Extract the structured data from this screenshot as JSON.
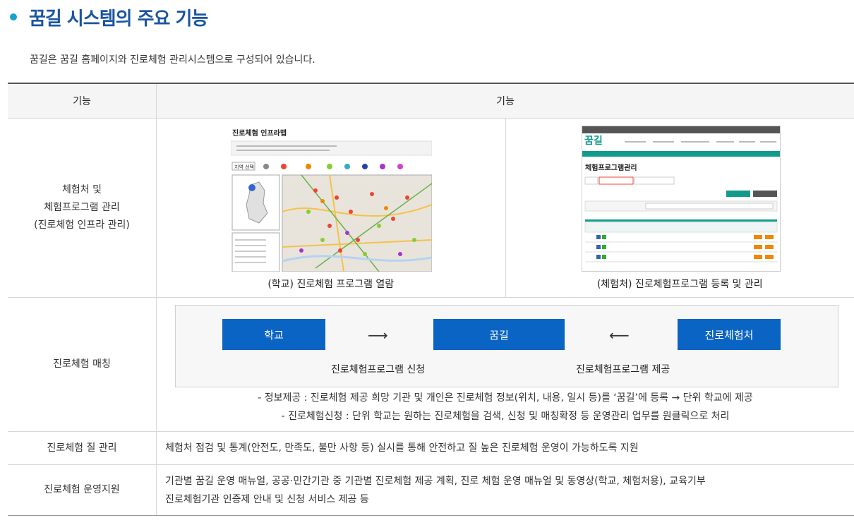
{
  "title": "꿈길 시스템의 주요 기능",
  "intro": "꿈길은 꿈길 홈페이지와 진로체험 관리시스템으로 구성되어 있습니다.",
  "table": {
    "header": [
      "기능",
      "기능"
    ],
    "rows": [
      {
        "label": [
          "체험처 및",
          "체험프로그램 관리",
          "(진로체험 인프라 관리)"
        ],
        "shots": [
          {
            "caption": "(학교) 진로체험 프로그램 열람",
            "heading": "진로체험 인프라맵",
            "region_select": "지역 선택"
          },
          {
            "caption": "(체험처) 진로체험프로그램 등록 및 관리",
            "logo": "꿈길",
            "heading": "체험프로그램관리"
          }
        ]
      },
      {
        "label": "진로체험 매칭",
        "boxes": [
          "학교",
          "꿈길",
          "진로체험처"
        ],
        "left_label": "진로체험프로그램 신청",
        "right_label": "진로체험프로그램 제공",
        "notes": [
          "- 정보제공 : 진로체험 제공 희망 기관 및 개인은 진로체험 정보(위치, 내용, 일시 등)를 ‘꿈길’에 등록 → 단위 학교에 제공",
          "- 진로체험신청 : 단위 학교는 원하는 진로체험을 검색, 신청 및 매칭확정 등 운영관리 업무를 원클릭으로 처리"
        ]
      },
      {
        "label": "진로체험 질 관리",
        "text": "체험처 점검 및 통계(안전도, 만족도, 불만 사항 등) 실시를 통해 안전하고 질 높은 진로체험 운영이 가능하도록 지원"
      },
      {
        "label": "진로체험 운영지원",
        "text": [
          "기관별 꿈길 운영 매뉴얼, 공공·민간기관 중 기관별 진로체험 제공 계획, 진로 체험 운영 매뉴얼 및 동영상(학교, 체험처용), 교육기부",
          "진로체험기관 인증제 안내 및 신청 서비스 제공 등"
        ]
      }
    ]
  }
}
